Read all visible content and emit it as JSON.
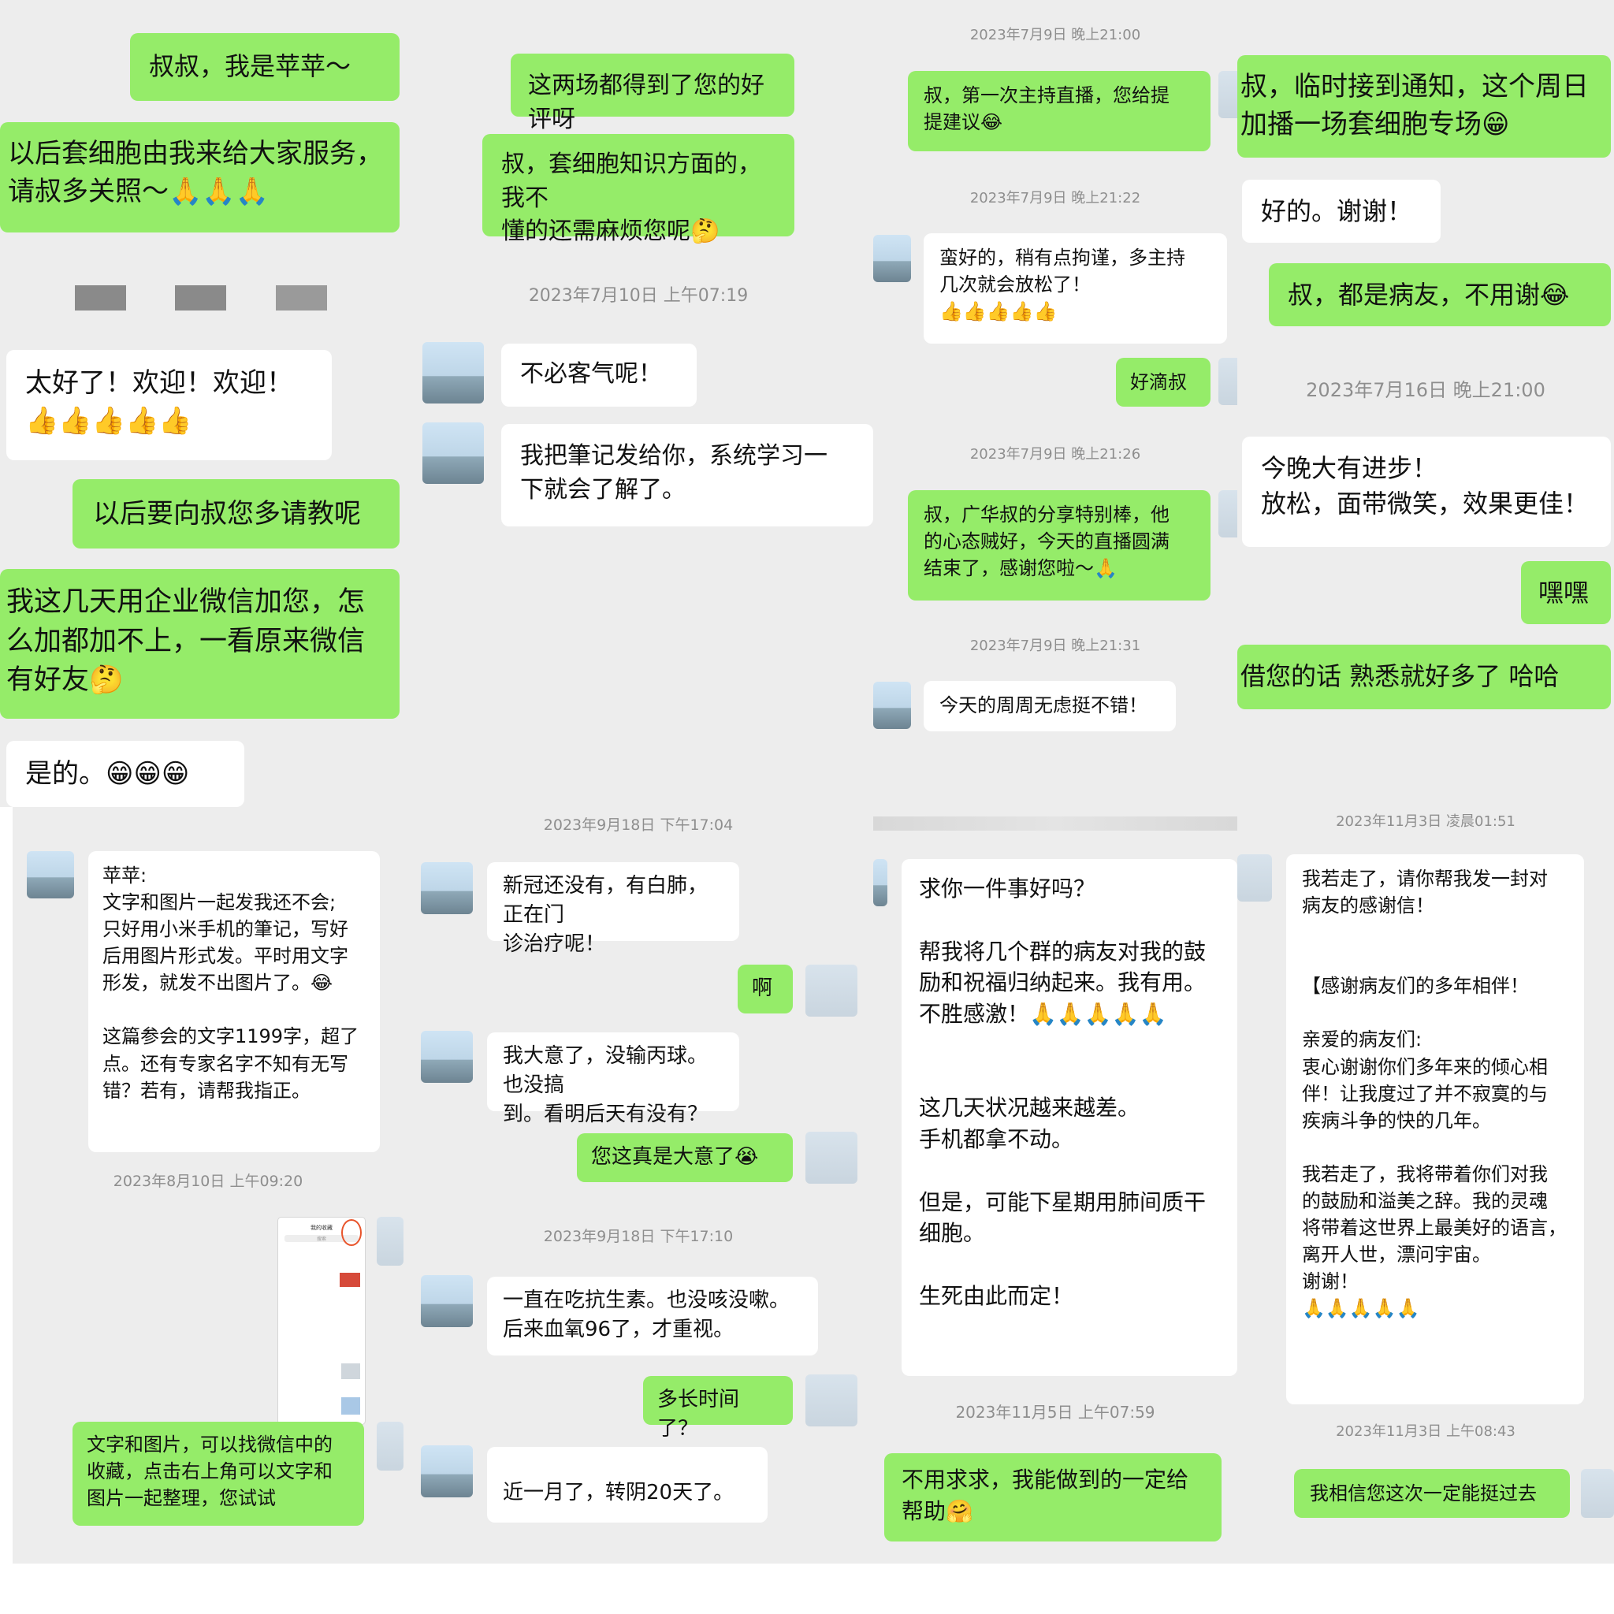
{
  "p1": {
    "m1": "叔叔，我是苹苹～",
    "m2": "以后套细胞由我来给大家服务，\n请叔多关照～🙏🙏🙏",
    "m3": "太好了！欢迎！欢迎！\n👍👍👍👍👍",
    "m4": "以后要向叔您多请教呢",
    "m5": "我这几天用企业微信加您，怎\n么加都加不上，一看原来微信\n有好友🤔",
    "m6": "是的。😁😁😁"
  },
  "p2": {
    "m1": "这两场都得到了您的好评呀",
    "m2": "叔，套细胞知识方面的，我不\n懂的还需麻烦您呢🤔",
    "ts1": "2023年7月10日 上午07:19",
    "m3": "不必客气呢！",
    "m4": "我把筆记发给你，系统学习一\n下就会了解了。"
  },
  "p3": {
    "ts1": "2023年7月9日 晚上21:00",
    "m1": "叔，第一次主持直播，您给提\n提建议😂",
    "ts2": "2023年7月9日 晚上21:22",
    "m2": "蛮好的，稍有点拘谨，多主持\n几次就会放松了！\n👍👍👍👍👍",
    "m3": "好滴叔",
    "ts3": "2023年7月9日 晚上21:26",
    "m4": "叔，广华叔的分享特别棒，他\n的心态贼好，今天的直播圆满\n结束了，感谢您啦～🙏",
    "ts4": "2023年7月9日 晚上21:31",
    "m5": "今天的周周无虑挺不错！"
  },
  "p4": {
    "m1": "叔，临时接到通知，这个周日\n加播一场套细胞专场😁",
    "m2": "好的。谢谢！",
    "m3": "叔，都是病友，不用谢😂",
    "ts1": "2023年7月16日 晚上21:00",
    "m4": "今晚大有进步！\n放松，面带微笑，效果更佳！",
    "m5": "嘿嘿",
    "m6": "借您的话 熟悉就好多了 哈哈"
  },
  "p5": {
    "m1": "苹苹:\n文字和图片一起发我还不会;\n只好用小米手机的筆记，写好\n后用图片形式发。平时用文字\n形发，就发不出图片了。😂\n\n这篇参会的文字1199字，超了\n点。还有专家名字不知有无写\n错？若有，请帮我指正。",
    "ts1": "2023年8月10日 上午09:20",
    "shot_title": "我的收藏",
    "shot_search": "搜索",
    "m2": "文字和图片，可以找微信中的\n收藏，点击右上角可以文字和\n图片一起整理，您试试"
  },
  "p6": {
    "ts1": "2023年9月18日 下午17:04",
    "m1": "新冠还没有，有白肺，正在门\n诊治疗呢！",
    "m2": "啊",
    "m3": "我大意了，没输丙球。也没搞\n到。看明后天有没有？",
    "m4": "您这真是大意了😭",
    "ts2": "2023年9月18日 下午17:10",
    "m5": "一直在吃抗生素。也没咳没嗽。\n后来血氧96了，才重视。",
    "m6": "多长时间了？",
    "m7": "近一月了，转阴20天了。"
  },
  "p7": {
    "m1": "求你一件事好吗？\n\n帮我将几个群的病友对我的鼓\n励和祝福归纳起来。我有用。\n不胜感激！🙏🙏🙏🙏🙏\n\n\n这几天状况越来越差。\n手机都拿不动。\n\n但是，可能下星期用肺间质干\n细胞。\n\n生死由此而定！",
    "ts1": "2023年11月5日 上午07:59",
    "m2": "不用求求，我能做到的一定给\n帮助🤗"
  },
  "p8": {
    "ts1": "2023年11月3日 凌晨01:51",
    "m1": "我若走了，请你帮我发一封对\n病友的感谢信！\n\n\n【感谢病友们的多年相伴！\n\n亲爱的病友们:\n衷心谢谢你们多年来的倾心相\n伴！让我度过了并不寂寞的与\n疾病斗争的快的几年。\n\n我若走了，我将带着你们对我\n的鼓励和溢美之辞。我的灵魂\n将带着这世界上最美好的语言，\n离开人世，漂问宇宙。\n谢谢！\n🙏🙏🙏🙏🙏",
    "ts2": "2023年11月3日 上午08:43",
    "m2": "我相信您这次一定能挺过去"
  },
  "colors": {
    "green": "#95ec69",
    "white": "#ffffff",
    "chat_bg": "#ededed",
    "timestamp": "#8e8e8e"
  }
}
